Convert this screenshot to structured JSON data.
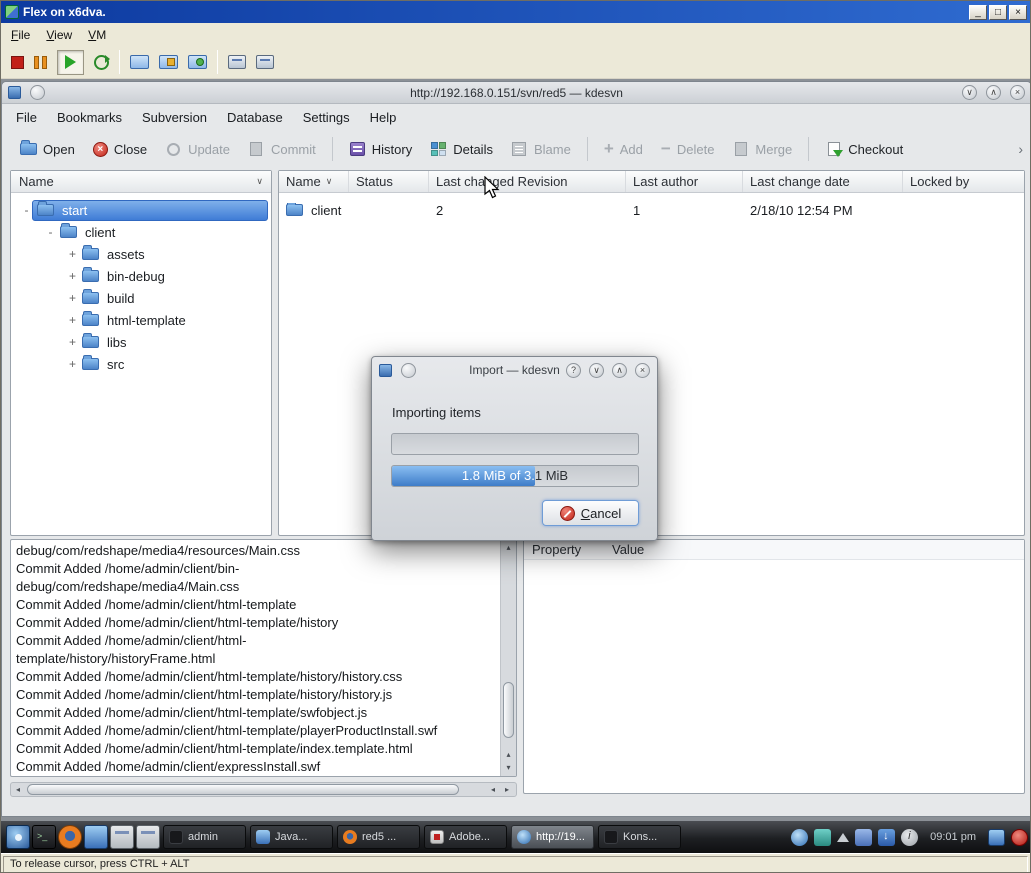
{
  "vm": {
    "title": "Flex on x6dva.",
    "menus": [
      "File",
      "View",
      "VM"
    ],
    "toolbar_icons": [
      "stop-icon",
      "pause-icon",
      "play-icon",
      "refresh-icon",
      "fullscreen-icon",
      "snapshot-icon",
      "revert-icon",
      "settings-icon",
      "unity-icon"
    ],
    "status_text": "To release cursor, press CTRL + ALT"
  },
  "app": {
    "title": "http://192.168.0.151/svn/red5 — kdesvn",
    "menus": [
      "File",
      "Bookmarks",
      "Subversion",
      "Database",
      "Settings",
      "Help"
    ],
    "toolbar": [
      {
        "label": "Open",
        "enabled": true
      },
      {
        "label": "Close",
        "enabled": true
      },
      {
        "label": "Update",
        "enabled": false
      },
      {
        "label": "Commit",
        "enabled": false
      },
      {
        "label": "History",
        "enabled": true
      },
      {
        "label": "Details",
        "enabled": true
      },
      {
        "label": "Blame",
        "enabled": false
      },
      {
        "label": "Add",
        "enabled": false
      },
      {
        "label": "Delete",
        "enabled": false
      },
      {
        "label": "Merge",
        "enabled": false
      },
      {
        "label": "Checkout",
        "enabled": true
      }
    ],
    "tree": {
      "header": "Name",
      "items": [
        {
          "label": "start",
          "selected": true
        },
        {
          "label": "client",
          "selected": false
        },
        {
          "label": "assets",
          "selected": false
        },
        {
          "label": "bin-debug",
          "selected": false
        },
        {
          "label": "build",
          "selected": false
        },
        {
          "label": "html-template",
          "selected": false
        },
        {
          "label": "libs",
          "selected": false
        },
        {
          "label": "src",
          "selected": false
        }
      ]
    },
    "list": {
      "columns": [
        "Name",
        "Status",
        "Last changed Revision",
        "Last author",
        "Last change date",
        "Locked by"
      ],
      "row": {
        "name": "client",
        "status": "",
        "revision": "2",
        "author": "1",
        "date": "2/18/10 12:54 PM",
        "locked": ""
      }
    },
    "dialog": {
      "title": "Import — kdesvn",
      "message": "Importing items",
      "progress_text": "1.8 MiB of 3.1 MiB",
      "progress_percent": 58,
      "cancel_label": "Cancel"
    },
    "log": {
      "lines": [
        "debug/com/redshape/media4/resources/Main.css",
        "Commit Added /home/admin/client/bin-",
        "debug/com/redshape/media4/Main.css",
        "Commit Added /home/admin/client/html-template",
        "Commit Added /home/admin/client/html-template/history",
        "Commit Added /home/admin/client/html-",
        "template/history/historyFrame.html",
        "Commit Added /home/admin/client/html-template/history/history.css",
        "Commit Added /home/admin/client/html-template/history/history.js",
        "Commit Added /home/admin/client/html-template/swfobject.js",
        "Commit Added /home/admin/client/html-template/playerProductInstall.swf",
        "Commit Added /home/admin/client/html-template/index.template.html",
        "Commit Added /home/admin/client/expressInstall.swf"
      ]
    },
    "props": {
      "columns": [
        "Property",
        "Value"
      ]
    }
  },
  "taskbar": {
    "launcher_icons": [
      "kmenu-icon",
      "terminal-launcher-icon",
      "firefox-launcher-icon",
      "desktop-launcher-icon",
      "window-list-icon",
      "show-desktop-icon"
    ],
    "tasks": [
      {
        "label": "admin",
        "active": false
      },
      {
        "label": "Java...",
        "active": false
      },
      {
        "label": "red5 ...",
        "active": false
      },
      {
        "label": "Adobe...",
        "active": false
      },
      {
        "label": "http://19...",
        "active": true
      },
      {
        "label": "Kons...",
        "active": false
      }
    ],
    "tray_icons": [
      "konqueror-tray-icon",
      "network-tray-icon",
      "panel-expand-icon",
      "klipper-tray-icon",
      "download-tray-icon",
      "info-tray-icon"
    ],
    "tray_icons_right": [
      "display-tray-icon",
      "power-tray-icon"
    ],
    "clock": "09:01 pm"
  },
  "glyphs": {
    "minimize": "∨",
    "maximize": "∧",
    "close": "×",
    "help": "?",
    "minus": "-",
    "plus": "+",
    "sort_down": "∨",
    "combo_down": "∨",
    "overflow": "›",
    "up": "▴",
    "down": "▾",
    "left": "◂",
    "right": "▸",
    "win_min": "_",
    "win_max": "□"
  },
  "colors": {
    "selection_blue": "#3f7cd6",
    "progress_blue": "#3e7cc8",
    "vm_titlebar_blue": "#0d3aa0",
    "close_red": "#c22418",
    "taskbar_dark": "#1d1f22"
  }
}
